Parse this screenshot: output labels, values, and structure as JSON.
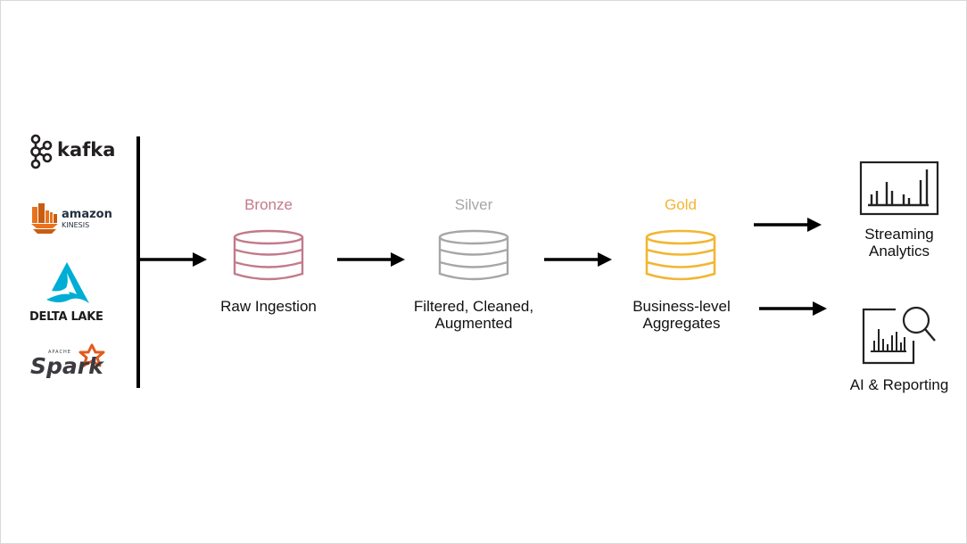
{
  "sources": [
    {
      "name": "kafka",
      "label": "kafka"
    },
    {
      "name": "amazon-kinesis",
      "label": "amazon",
      "sublabel": "KINESIS"
    },
    {
      "name": "delta-lake",
      "label": "DELTA LAKE"
    },
    {
      "name": "apache-spark",
      "label": "Spark",
      "sublabel": "APACHE"
    }
  ],
  "tiers": [
    {
      "name": "bronze",
      "title": "Bronze",
      "description": "Raw Ingestion",
      "color": "#c27a8a"
    },
    {
      "name": "silver",
      "title": "Silver",
      "description": "Filtered, Cleaned,\nAugmented",
      "color": "#a6a6a6"
    },
    {
      "name": "gold",
      "title": "Gold",
      "description": "Business-level\nAggregates",
      "color": "#f2b632"
    }
  ],
  "outputs": [
    {
      "name": "streaming-analytics",
      "label": "Streaming\nAnalytics"
    },
    {
      "name": "ai-reporting",
      "label": "AI & Reporting"
    }
  ],
  "colors": {
    "kafka": "#231f20",
    "kinesis": "#e8731f",
    "delta": "#00add4",
    "spark": "#e25a1c"
  }
}
